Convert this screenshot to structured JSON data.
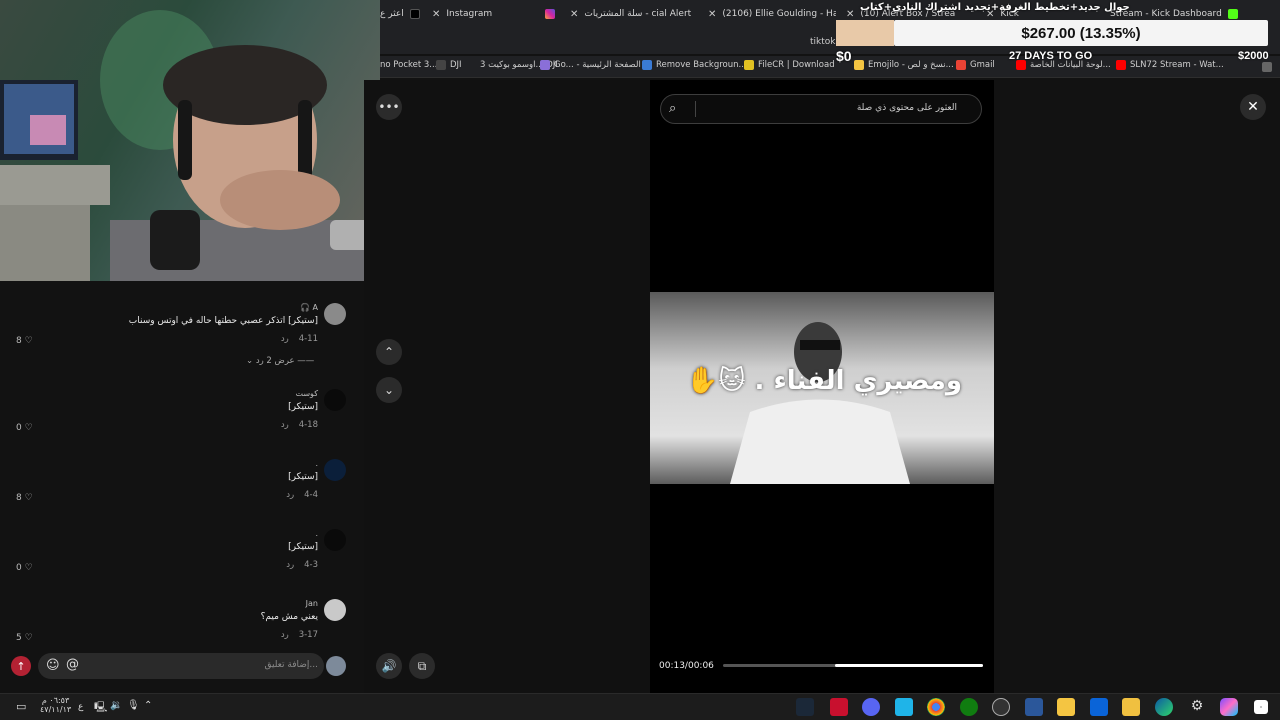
{
  "stream_overlay": {
    "title": "جوال جديد+تخطيط الغرفة+تجديد اشتراك النادي+كتاب",
    "goal_amount": "$267.00 (13.35%)",
    "goal_start": "$0",
    "goal_end": "$2000",
    "days_left": "27 DAYS TO GO",
    "goal_progress": 0.1335
  },
  "tabs": [
    {
      "label": "اعثر ع",
      "icon": "tiktok-icon"
    },
    {
      "label": "Instagram",
      "icon": "instagram-icon"
    },
    {
      "label": "سلة المشتريات - cial Alert",
      "icon": "alert-icon"
    },
    {
      "label": "(2106) Ellie Goulding - Ha",
      "icon": "youtube-icon"
    },
    {
      "label": "(10) Alert Box / Stream",
      "icon": "alert-icon"
    },
    {
      "label": "Kick",
      "icon": "kick-icon"
    },
    {
      "label": "Stream - Kick Dashboard",
      "icon": "kick-icon"
    }
  ],
  "address": "tiktok",
  "bookmarks": [
    "no Pocket 3...",
    "DJI",
    "اوسمو بوكيت 3... DJI",
    "Go... - الصفحة الرئيسية",
    "Remove Backgroun...",
    "FileCR | Download",
    "Emojilo - نسخ و لص...",
    "Gmail",
    "لوحة البيانات الخاصة...",
    "SLN72 Stream - Wat..."
  ],
  "search": {
    "placeholder": "العثور على محتوى ذي صلة"
  },
  "video": {
    "caption": "ومصيري الفناء .",
    "time": "00:13/00:06",
    "progress": 0.57
  },
  "comments": [
    {
      "user": "A 🎧",
      "text": "[ستيكر] اتذكر عصبي حطتها حاله في اوتس وسناب",
      "date": "4-11",
      "reply": "رد",
      "likes": "8",
      "avatar_color": "#8a8a8a"
    },
    {
      "user": "كوست",
      "text": "[ستيكر]",
      "date": "4-18",
      "reply": "رد",
      "likes": "0",
      "avatar_color": "#0a0a0a"
    },
    {
      "user": ".",
      "text": "[ستيكر]",
      "date": "4-4",
      "reply": "رد",
      "likes": "8",
      "avatar_color": "#0b1f3a"
    },
    {
      "user": ".",
      "text": "[ستيكر]",
      "date": "4-3",
      "reply": "رد",
      "likes": "0",
      "avatar_color": "#0a0a0a"
    },
    {
      "user": "Jan",
      "text": "يعني مش ميم؟",
      "date": "3-17",
      "reply": "رد",
      "likes": "5",
      "avatar_color": "#c9c9c9"
    }
  ],
  "view_replies": "عرض 2 رد",
  "comment_input": {
    "placeholder": "إضافة تعليق..."
  },
  "clock": {
    "time": "٠٦:٥٣ م",
    "date": "٤٧/١١/١٣"
  },
  "colors": {
    "accent": "#fe2c55",
    "goal_bar": "#f4f4f4"
  }
}
